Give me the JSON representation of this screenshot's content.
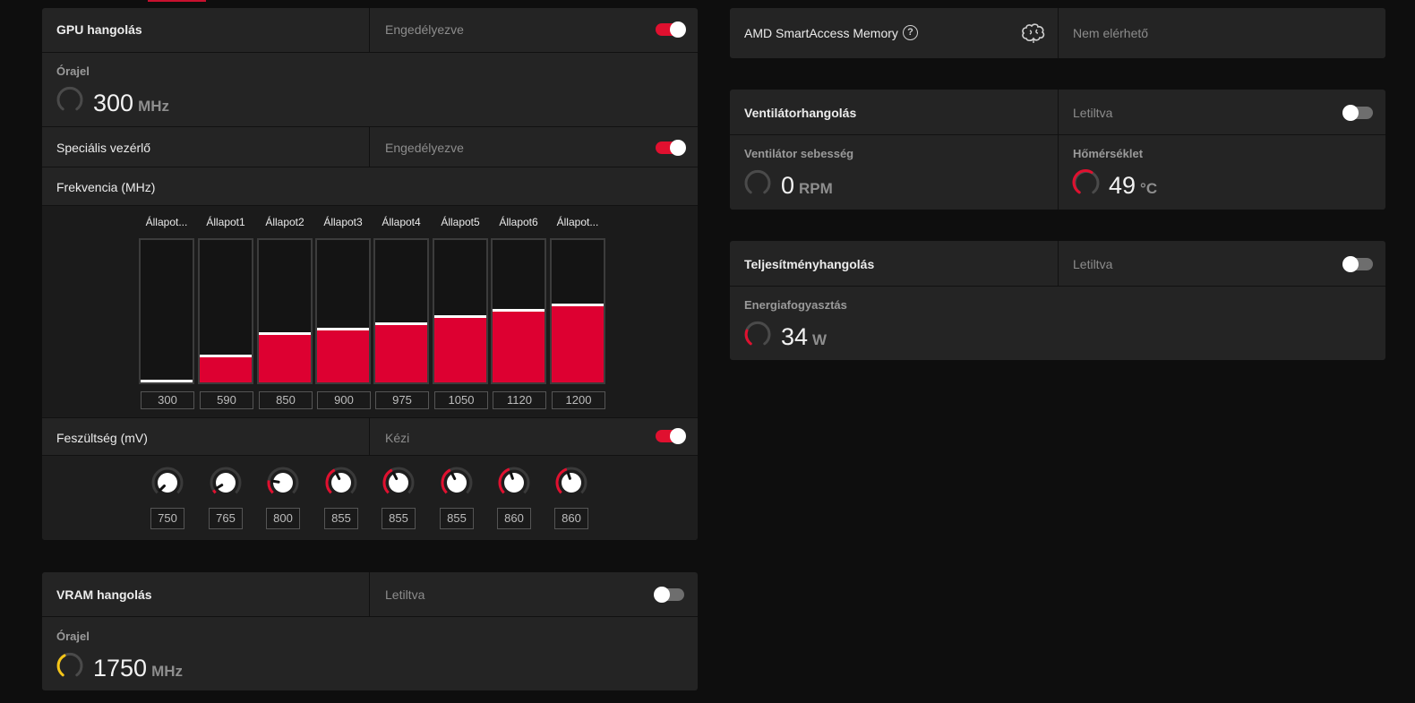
{
  "gpu_tuning": {
    "title": "GPU hangolás",
    "status": "Engedélyezve",
    "enabled": true,
    "clock_label": "Órajel",
    "clock_value": "300",
    "clock_unit": "MHz"
  },
  "advanced_control": {
    "label": "Speciális vezérlő",
    "status": "Engedélyezve",
    "enabled": true
  },
  "frequency": {
    "label": "Frekvencia (MHz)",
    "states": [
      {
        "name": "Állapot...",
        "value": "300",
        "level": 0.0
      },
      {
        "name": "Állapot1",
        "value": "590",
        "level": 0.18
      },
      {
        "name": "Állapot2",
        "value": "850",
        "level": 0.34
      },
      {
        "name": "Állapot3",
        "value": "900",
        "level": 0.37
      },
      {
        "name": "Állapot4",
        "value": "975",
        "level": 0.41
      },
      {
        "name": "Állapot5",
        "value": "1050",
        "level": 0.46
      },
      {
        "name": "Állapot6",
        "value": "1120",
        "level": 0.5
      },
      {
        "name": "Állapot...",
        "value": "1200",
        "level": 0.54
      }
    ]
  },
  "voltage": {
    "label": "Feszültség (mV)",
    "mode": "Kézi",
    "enabled": true,
    "values": [
      "750",
      "765",
      "800",
      "855",
      "855",
      "855",
      "860",
      "860"
    ],
    "levels": [
      0.0,
      0.05,
      0.2,
      0.4,
      0.4,
      0.4,
      0.43,
      0.43
    ]
  },
  "vram_tuning": {
    "title": "VRAM hangolás",
    "status": "Letiltva",
    "enabled": false,
    "clock_label": "Órajel",
    "clock_value": "1750",
    "clock_unit": "MHz"
  },
  "smart_access": {
    "title": "AMD SmartAccess Memory",
    "help": "?",
    "status": "Nem elérhető"
  },
  "fan_tuning": {
    "title": "Ventilátorhangolás",
    "status": "Letiltva",
    "enabled": false,
    "speed_label": "Ventilátor sebesség",
    "speed_value": "0",
    "speed_unit": "RPM",
    "temp_label": "Hőmérséklet",
    "temp_value": "49",
    "temp_unit": "°C"
  },
  "perf_tuning": {
    "title": "Teljesítményhangolás",
    "status": "Letiltva",
    "enabled": false,
    "power_label": "Energiafogyasztás",
    "power_value": "34",
    "power_unit": "W"
  },
  "colors": {
    "accent": "#e0102f",
    "vram_gauge": "#f5c518",
    "panel": "#242424",
    "background": "#0e0e0e"
  }
}
